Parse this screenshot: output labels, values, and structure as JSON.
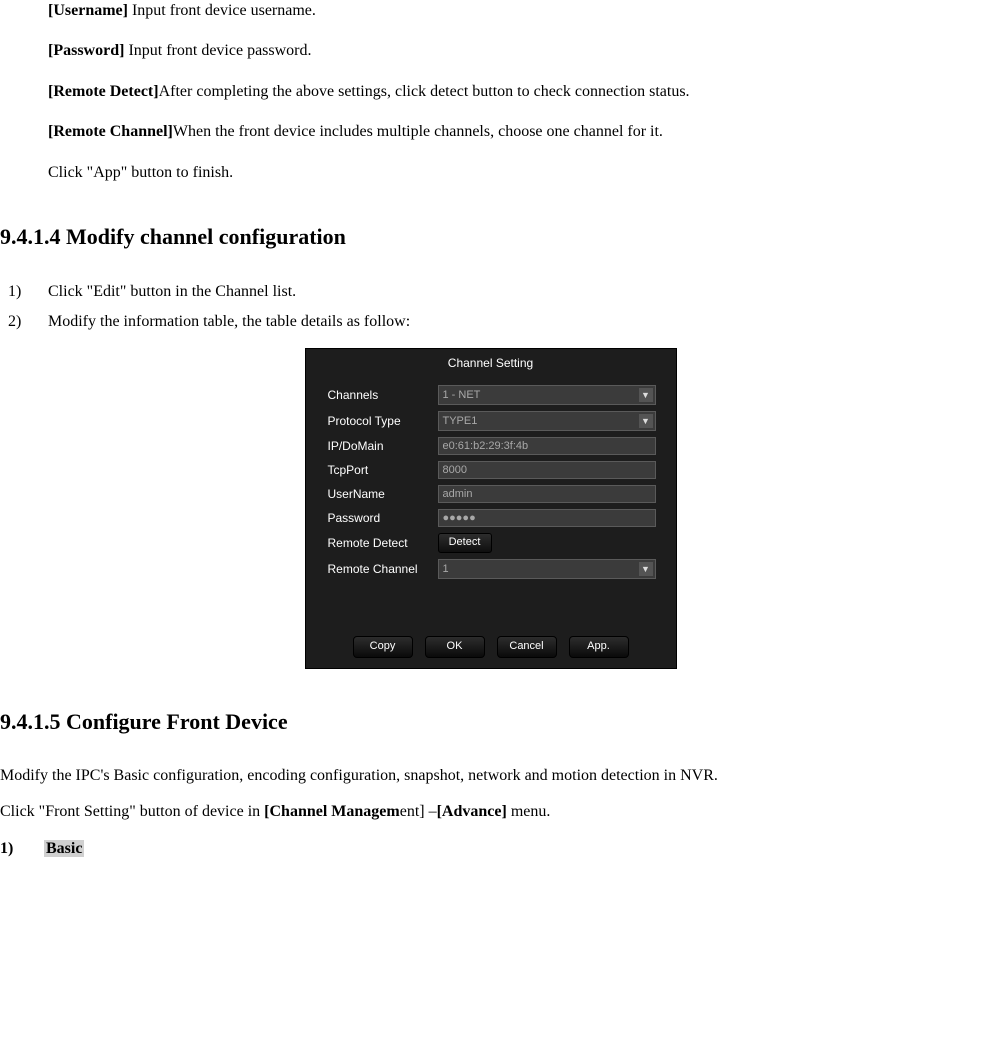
{
  "intro": {
    "username_label": "[Username]",
    "username_text": " Input front device username.",
    "password_label": "[Password]",
    "password_text": " Input front device password.",
    "remote_detect_label": "[Remote Detect]",
    "remote_detect_text": "After completing the above settings, click detect button to check connection status.",
    "remote_channel_label": "[Remote Channel]",
    "remote_channel_text": "When the front device includes multiple channels, choose one channel for it.",
    "finish_text": "Click \"App\" button to finish."
  },
  "section_9_4_1_4": {
    "heading": "9.4.1.4 Modify channel configuration",
    "step1_num": "1)",
    "step1_text": "Click \"Edit\" button in the Channel list.",
    "step2_num": "2)",
    "step2_text": "Modify the information table, the table details as follow:"
  },
  "dialog": {
    "title": "Channel Setting",
    "channels_label": "Channels",
    "channels_value": "1 - NET",
    "protocol_label": "Protocol Type",
    "protocol_value": "TYPE1",
    "ip_label": "IP/DoMain",
    "ip_value": "e0:61:b2:29:3f:4b",
    "tcpport_label": "TcpPort",
    "tcpport_value": "8000",
    "username_label": "UserName",
    "username_value": "admin",
    "password_label": "Password",
    "password_value": "●●●●●",
    "remote_detect_label": "Remote Detect",
    "detect_btn": "Detect",
    "remote_channel_label": "Remote Channel",
    "remote_channel_value": "1",
    "btn_copy": "Copy",
    "btn_ok": "OK",
    "btn_cancel": "Cancel",
    "btn_app": "App."
  },
  "section_9_4_1_5": {
    "heading": "9.4.1.5 Configure Front Device",
    "p1": "Modify the IPC's Basic configuration, encoding configuration, snapshot, network and motion detection in NVR.",
    "p2_prefix": "Click \"Front Setting\" button of device in ",
    "p2_bold1": "[Channel Managem",
    "p2_mid": "ent] –",
    "p2_bold2": "[Advance]",
    "p2_suffix": " menu.",
    "sub_num": "1)",
    "sub_label": "Basic"
  }
}
